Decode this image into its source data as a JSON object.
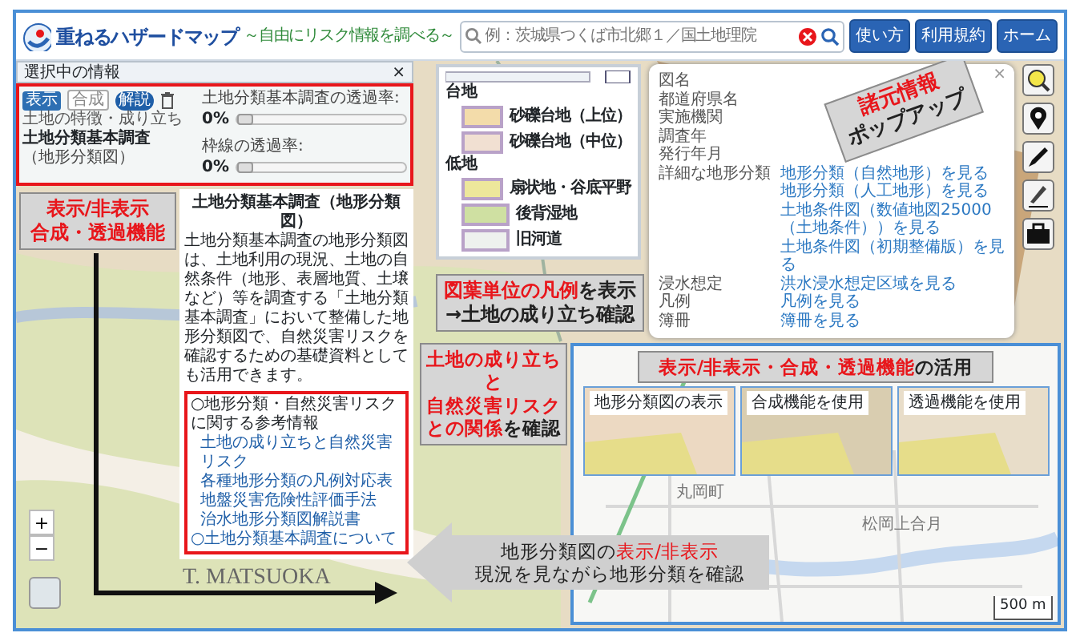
{
  "header": {
    "title": "重ねるハザードマップ",
    "subtitle": "～自由にリスク情報を調べる～",
    "search": {
      "placeholder": "例：茨城県つくば市北郷１／国土地理院"
    },
    "buttons": [
      "使い方",
      "利用規約",
      "ホーム"
    ]
  },
  "info_panel": {
    "title": "選択中の情報",
    "close": "×",
    "layer": {
      "badge": "表示",
      "category": "土地の特徴・成り立ち",
      "name": "土地分類基本調査",
      "name_sub": "（地形分類図）",
      "composite_button": "合成",
      "info_badge": "解説"
    },
    "sliders": [
      {
        "label": "土地分類基本調査の透過率:",
        "reading": "0%",
        "level": 0
      },
      {
        "label": "枠線の透過率:",
        "reading": "0%",
        "level": 0
      }
    ],
    "description_title": "土地分類基本調査（地形分類図）",
    "description": "土地分類基本調査の地形分類図は、土地利用の現況、土地の自然条件（地形、表層地質、土壌など）等を調査する「土地分類基本調査」において整備した地形分類図で、自然災害リスクを確認するための基礎資料としても活用できます。",
    "references": {
      "heading": "○地形分類・自然災害リスクに関する参考情報",
      "links": [
        "土地の成り立ちと自然災害リスク",
        "各種地形分類の凡例対応表",
        "地盤災害危険性評価手法",
        "治水地形分類図解説書"
      ],
      "footer": "○土地分類基本調査について"
    }
  },
  "legend_inset": {
    "groups": [
      {
        "heading": "台地",
        "items": [
          {
            "label": "砂礫台地（上位）",
            "color": "#f3dcaa"
          },
          {
            "label": "砂礫台地（中位）",
            "color": "#f1e0d2"
          }
        ]
      },
      {
        "heading": "低地",
        "items": [
          {
            "label": "扇状地・谷底平野",
            "color": "#ede79b"
          },
          {
            "label": "後背湿地",
            "color": "#cfe0a2"
          },
          {
            "label": "旧河道",
            "color": "#eef1ee"
          }
        ]
      }
    ]
  },
  "popup": {
    "close": "×",
    "rows": [
      {
        "label": "図名"
      },
      {
        "label": "都道府県名"
      },
      {
        "label": "実施機関"
      },
      {
        "label": "調査年"
      },
      {
        "label": "発行年月"
      },
      {
        "label": "詳細な地形分類",
        "links": [
          "地形分類（自然地形）を見る",
          "地形分類（人工地形）を見る",
          "土地条件図（数値地図25000（土地条件））を見る",
          "土地条件図（初期整備版）を見る"
        ]
      },
      {
        "label": "浸水想定",
        "links": [
          "洪水浸水想定区域を見る"
        ]
      },
      {
        "label": "凡例",
        "links": [
          "凡例を見る"
        ]
      },
      {
        "label": "簿冊",
        "links": [
          "簿冊を見る"
        ]
      }
    ]
  },
  "map": {
    "place_label": "T. MATSUOKA",
    "zoom_in": "+",
    "zoom_out": "−"
  },
  "callouts": {
    "panel": [
      [
        {
          "text": "表示/非表示",
          "highlight": true
        }
      ],
      [
        {
          "text": "合成・透過機能",
          "highlight": true
        }
      ]
    ],
    "legend": [
      [
        {
          "text": "図葉単位の凡例",
          "highlight": true
        },
        {
          "text": "を表示",
          "highlight": false
        }
      ],
      [
        {
          "text": "→土地の成り立ち確認",
          "highlight": false
        }
      ]
    ],
    "popup": [
      [
        {
          "text": "諸元情報",
          "highlight": true
        }
      ],
      [
        {
          "text": "ポップアップ",
          "highlight": false
        }
      ]
    ],
    "risk": [
      [
        {
          "text": "土地の成り立ちと",
          "highlight": true
        }
      ],
      [
        {
          "text": "自然災害リスク",
          "highlight": true
        }
      ],
      [
        {
          "text": "との関係",
          "highlight": true
        },
        {
          "text": "を確認",
          "highlight": false
        }
      ]
    ],
    "toggle": [
      [
        {
          "text": "地形分類図の",
          "highlight": false
        },
        {
          "text": "表示/非表示",
          "highlight": true
        }
      ],
      [
        {
          "text": "現況を見ながら地形分類を確認",
          "highlight": false
        }
      ]
    ]
  },
  "comparison_inset": {
    "title": [
      {
        "text": "表示/非表示・合成・透過機能",
        "highlight": true
      },
      {
        "text": "の活用",
        "highlight": false
      }
    ],
    "thumbnails": [
      {
        "label": "地形分類図の表示"
      },
      {
        "label": "合成機能を使用"
      },
      {
        "label": "透過機能を使用"
      }
    ],
    "place_labels": [
      "丸岡町",
      "松岡上合月"
    ],
    "scale": "500 m"
  }
}
